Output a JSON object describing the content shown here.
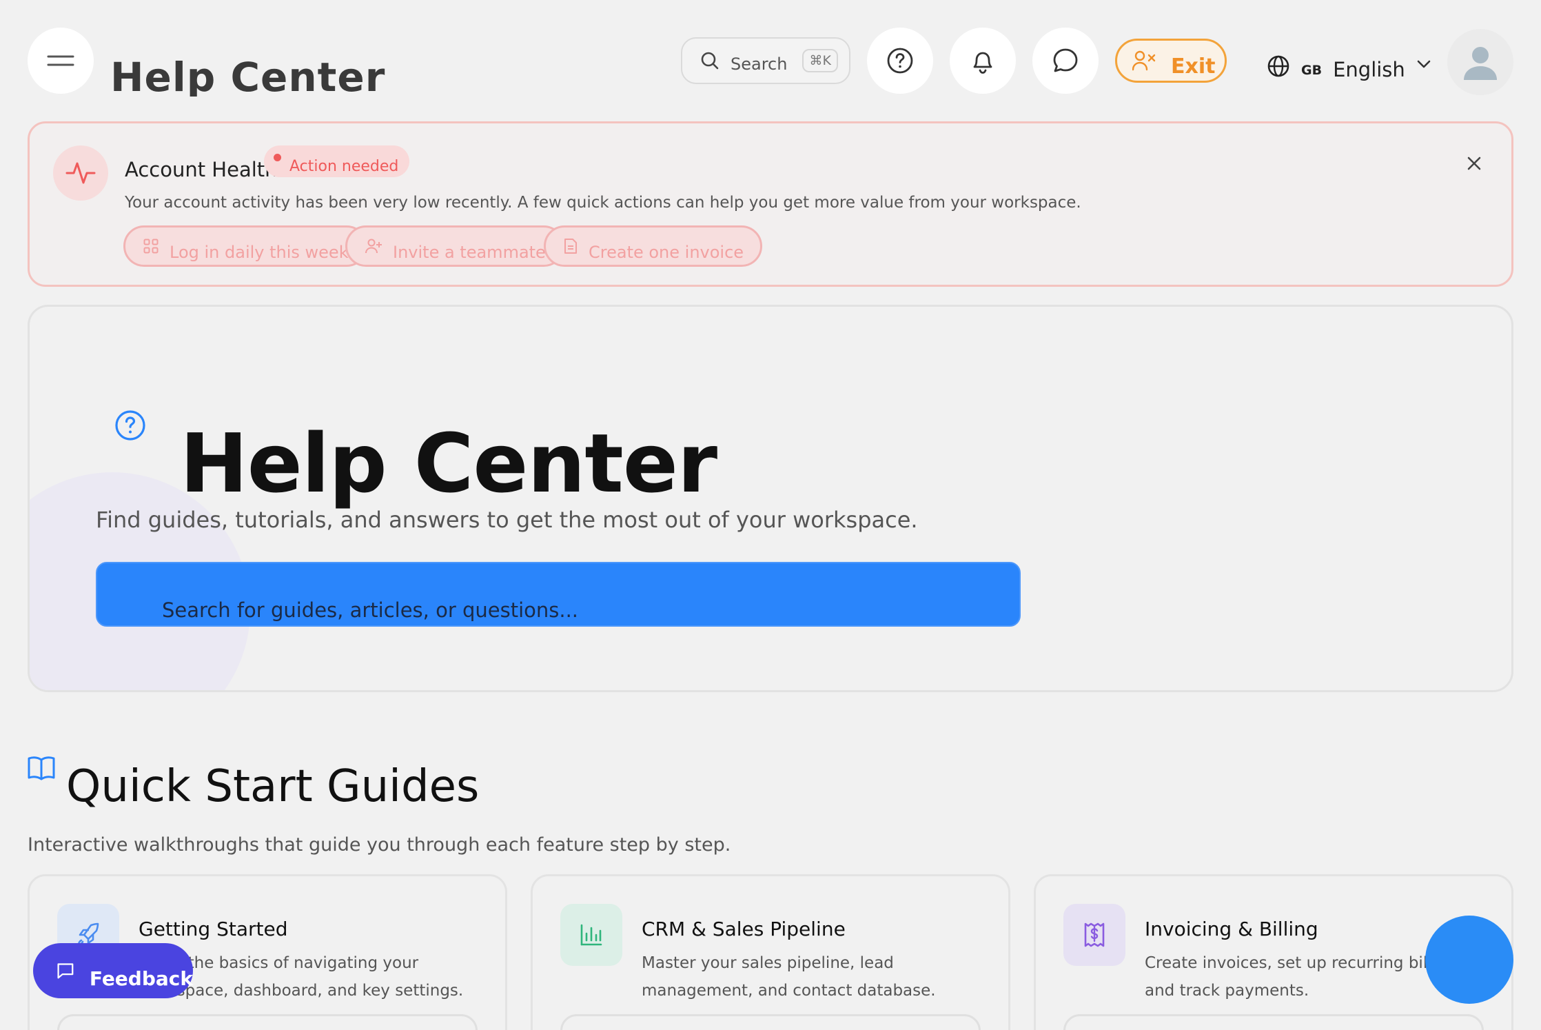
{
  "header": {
    "title": "Help Center",
    "search_label": "Search",
    "search_shortcut": "⌘K",
    "exit_label": "Exit",
    "language_code": "GB",
    "language_name": "English"
  },
  "account_health": {
    "title": "Account Health",
    "badge": "Action needed",
    "description": "Your account activity has been very low recently. A few quick actions can help you get more value from your workspace.",
    "actions": [
      {
        "label": "Log in daily this week",
        "icon": "grid-icon"
      },
      {
        "label": "Invite a teammate",
        "icon": "user-plus-icon"
      },
      {
        "label": "Create one invoice",
        "icon": "document-icon"
      }
    ]
  },
  "hero": {
    "title": "Help Center",
    "subtitle": "Find guides, tutorials, and answers to get the most out of your workspace.",
    "search_placeholder": "Search for guides, articles, or questions..."
  },
  "quick_start": {
    "title": "Quick Start Guides",
    "subtitle": "Interactive walkthroughs that guide you through each feature step by step.",
    "cards": [
      {
        "title": "Getting Started",
        "description": "Learn the basics of navigating your workspace, dashboard, and key settings.",
        "icon": "rocket-icon",
        "color": "#dfe8f6"
      },
      {
        "title": "CRM & Sales Pipeline",
        "description": "Master your sales pipeline, lead management, and contact database.",
        "icon": "chart-icon",
        "color": "#dcefe7"
      },
      {
        "title": "Invoicing & Billing",
        "description": "Create invoices, set up recurring billing, and track payments.",
        "icon": "invoice-icon",
        "color": "#e6e1f3"
      }
    ]
  },
  "feedback": {
    "label": "Feedback"
  },
  "colors": {
    "accent": "#2a85fb",
    "exit": "#f09028",
    "warning": "#ef5a5a",
    "feedback": "#4a44e0"
  }
}
